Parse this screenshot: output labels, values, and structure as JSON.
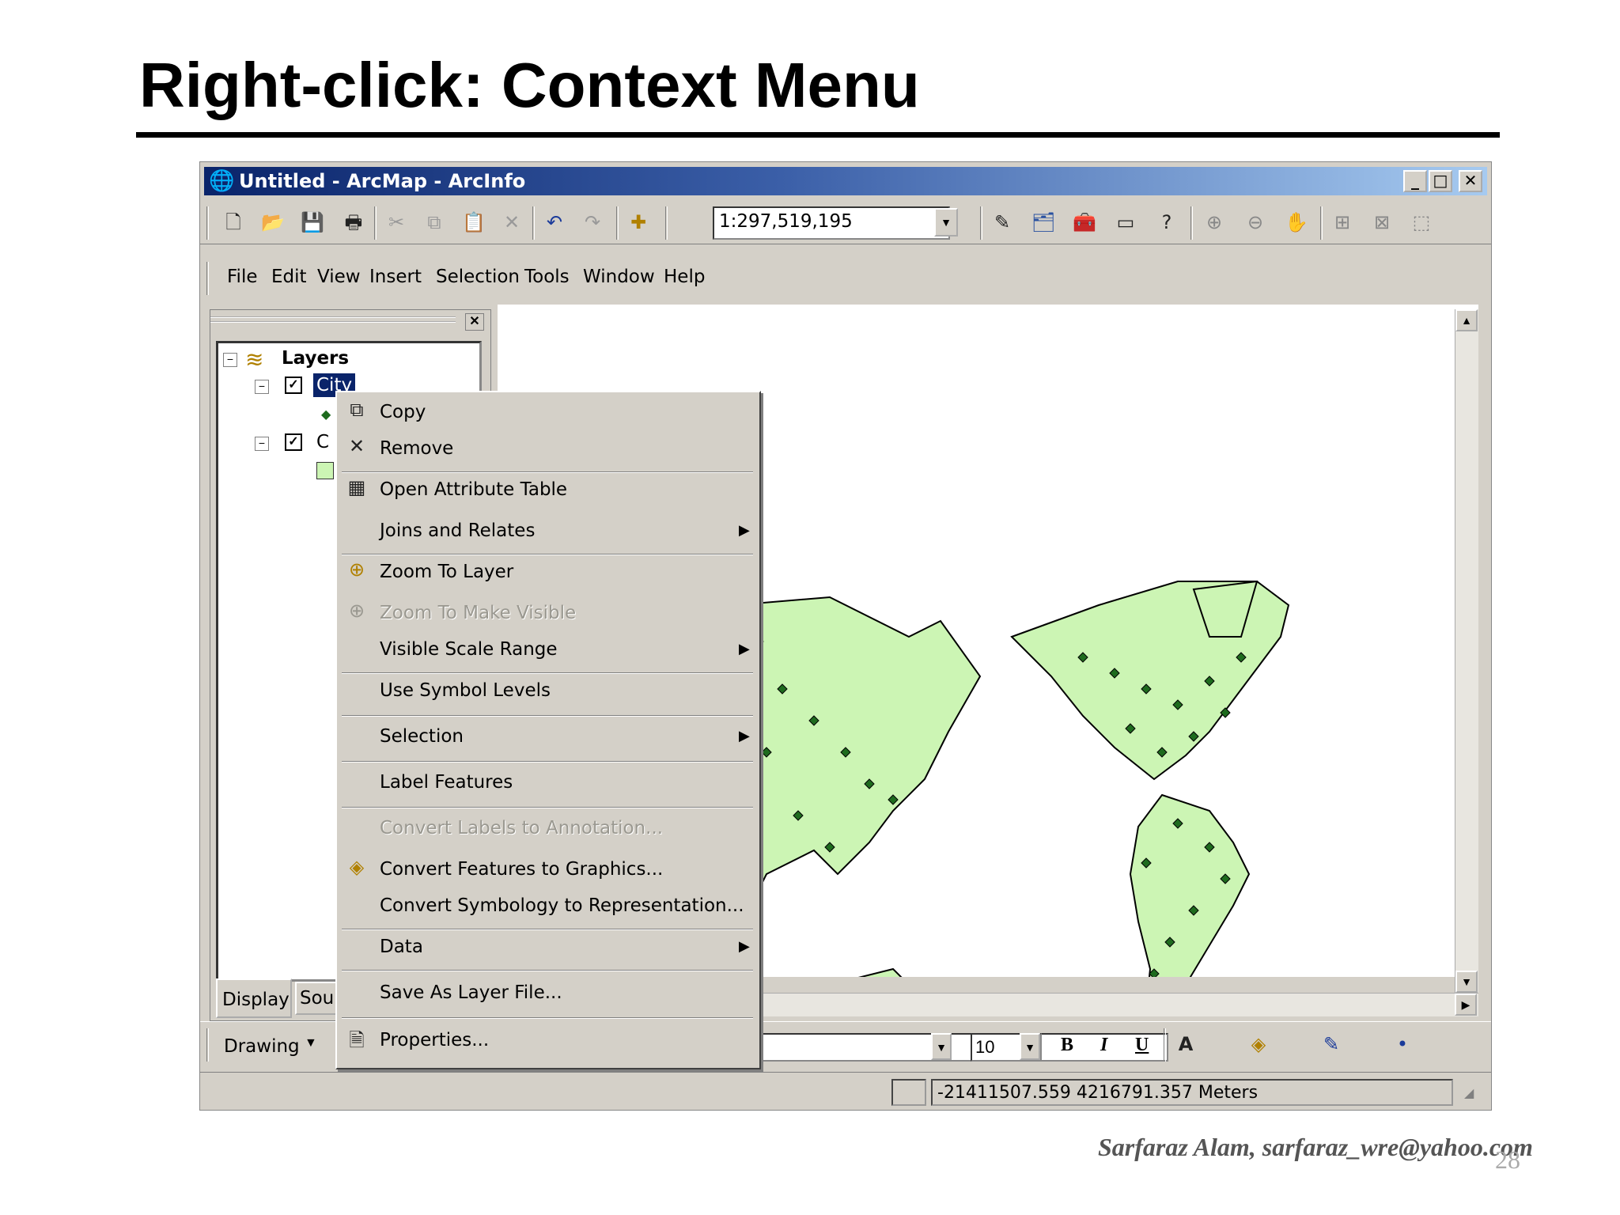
{
  "slide": {
    "title": "Right-click: Context Menu",
    "footer": "Sarfaraz Alam, sarfaraz_wre@yahoo.com",
    "page_number": "28"
  },
  "window": {
    "title": "Untitled - ArcMap - ArcInfo",
    "controls": {
      "minimize": "_",
      "maximize": "□",
      "close": "✕"
    }
  },
  "toolbar": {
    "scale_value": "1:297,519,195",
    "icons": [
      "new-icon",
      "open-icon",
      "save-icon",
      "print-icon",
      "cut-icon",
      "copy-icon",
      "paste-icon",
      "delete-icon",
      "undo-icon",
      "redo-icon",
      "add-data-icon"
    ]
  },
  "menubar": {
    "items": [
      "File",
      "Edit",
      "View",
      "Insert",
      "Selection",
      "Tools",
      "Window",
      "Help"
    ]
  },
  "toc": {
    "root_label": "Layers",
    "layers": [
      {
        "label": "City",
        "selected": true,
        "checked": true
      },
      {
        "label": "C",
        "selected": false,
        "checked": true
      }
    ],
    "tabs": {
      "display": "Display",
      "source": "Sou"
    }
  },
  "context_menu": {
    "items": [
      {
        "label": "Copy",
        "icon": "copy-icon",
        "disabled": false,
        "submenu": false
      },
      {
        "label": "Remove",
        "icon": "remove-icon",
        "disabled": false,
        "submenu": false
      },
      {
        "label": "Open Attribute Table",
        "icon": "table-icon",
        "disabled": false,
        "submenu": false
      },
      {
        "label": "Joins and Relates",
        "icon": "",
        "disabled": false,
        "submenu": true
      },
      {
        "label": "Zoom To Layer",
        "icon": "zoom-layer-icon",
        "disabled": false,
        "submenu": false
      },
      {
        "label": "Zoom To Make Visible",
        "icon": "zoom-visible-icon",
        "disabled": true,
        "submenu": false
      },
      {
        "label": "Visible Scale Range",
        "icon": "",
        "disabled": false,
        "submenu": true
      },
      {
        "label": "Use Symbol Levels",
        "icon": "",
        "disabled": false,
        "submenu": false
      },
      {
        "label": "Selection",
        "icon": "",
        "disabled": false,
        "submenu": true
      },
      {
        "label": "Label Features",
        "icon": "",
        "disabled": false,
        "submenu": false
      },
      {
        "label": "Convert Labels to Annotation...",
        "icon": "",
        "disabled": true,
        "submenu": false
      },
      {
        "label": "Convert Features to Graphics...",
        "icon": "convert-graphics-icon",
        "disabled": false,
        "submenu": false
      },
      {
        "label": "Convert Symbology to Representation...",
        "icon": "",
        "disabled": false,
        "submenu": false
      },
      {
        "label": "Data",
        "icon": "",
        "disabled": false,
        "submenu": true
      },
      {
        "label": "Save As Layer File...",
        "icon": "",
        "disabled": false,
        "submenu": false
      },
      {
        "label": "Properties...",
        "icon": "properties-icon",
        "disabled": false,
        "submenu": false
      }
    ]
  },
  "drawing_toolbar": {
    "drawing_label": "Drawing",
    "font_size": "10",
    "bold": "B",
    "italic": "I",
    "underline": "U"
  },
  "status": {
    "coordinates": "-21411507.559  4216791.357 Meters"
  },
  "colors": {
    "land": "#ccf5b4",
    "city_point": "#1e6b1e",
    "title_bar_start": "#0a246a",
    "title_bar_end": "#a6caf0"
  }
}
